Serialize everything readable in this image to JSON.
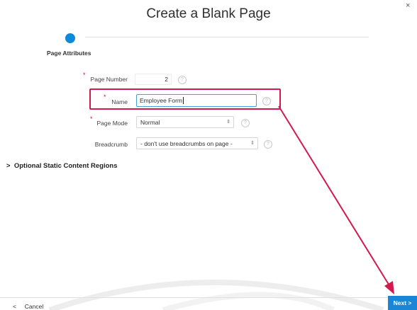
{
  "dialog": {
    "title": "Create a Blank Page",
    "close_icon": "×"
  },
  "wizard": {
    "step_label": "Page Attributes",
    "accent": "#0e88d8"
  },
  "form": {
    "page_number": {
      "label": "Page Number",
      "value": "2",
      "required": true
    },
    "name": {
      "label": "Name",
      "value": "Employee Form",
      "required": true
    },
    "page_mode": {
      "label": "Page Mode",
      "value": "Normal",
      "required": true
    },
    "breadcrumb": {
      "label": "Breadcrumb",
      "value": "- don't use breadcrumbs on page -",
      "required": false
    }
  },
  "sections": {
    "optional_regions": "Optional Static Content Regions"
  },
  "footer": {
    "cancel": "Cancel",
    "next": "Next"
  },
  "annotation": {
    "color": "#d31a4f"
  }
}
